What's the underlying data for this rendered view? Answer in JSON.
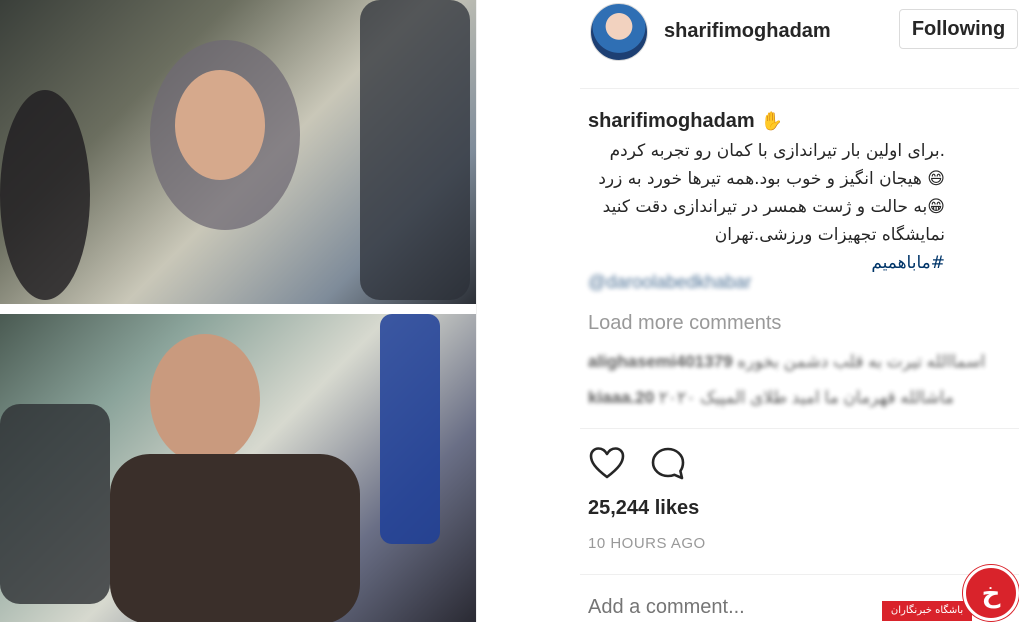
{
  "header": {
    "username": "sharifimoghadam",
    "follow_label": "Following"
  },
  "caption": {
    "username": "sharifimoghadam",
    "user_emoji": "✋",
    "lines": [
      ".برای اولین بار تیراندازی با کمان رو تجربه کردم",
      "😄 هیجان انگیز و خوب بود.همه تیرها خورد به زرد",
      "😁به حالت و ژست همسر در تیراندازی دقت کنید",
      "نمایشگاه تجهیزات ورزشی.تهران"
    ],
    "hashtag": "#ماباهمیم",
    "mention": "@daroolabedkhabar"
  },
  "comments": {
    "load_more": "Load more comments",
    "items": [
      {
        "user": "alighasemi401379",
        "text": "اسماالله تیرت به قلب دشمن بخوره"
      },
      {
        "user": "kiaaa.20",
        "text": "ماشالله قهرمان ما امید طلای المپیک ۲۰۲۰"
      }
    ]
  },
  "actions": {
    "like_icon": "heart-icon",
    "comment_icon": "speech-bubble-icon"
  },
  "likes": "25,244 likes",
  "timestamp": "10 HOURS AGO",
  "add_comment_placeholder": "Add a comment...",
  "watermark": {
    "logo_glyph": "خ",
    "text": "باشگاه خبرنگاران"
  },
  "colors": {
    "link": "#003569",
    "muted": "#999999",
    "border": "#dbdbdb",
    "brand_red": "#d9232b"
  }
}
